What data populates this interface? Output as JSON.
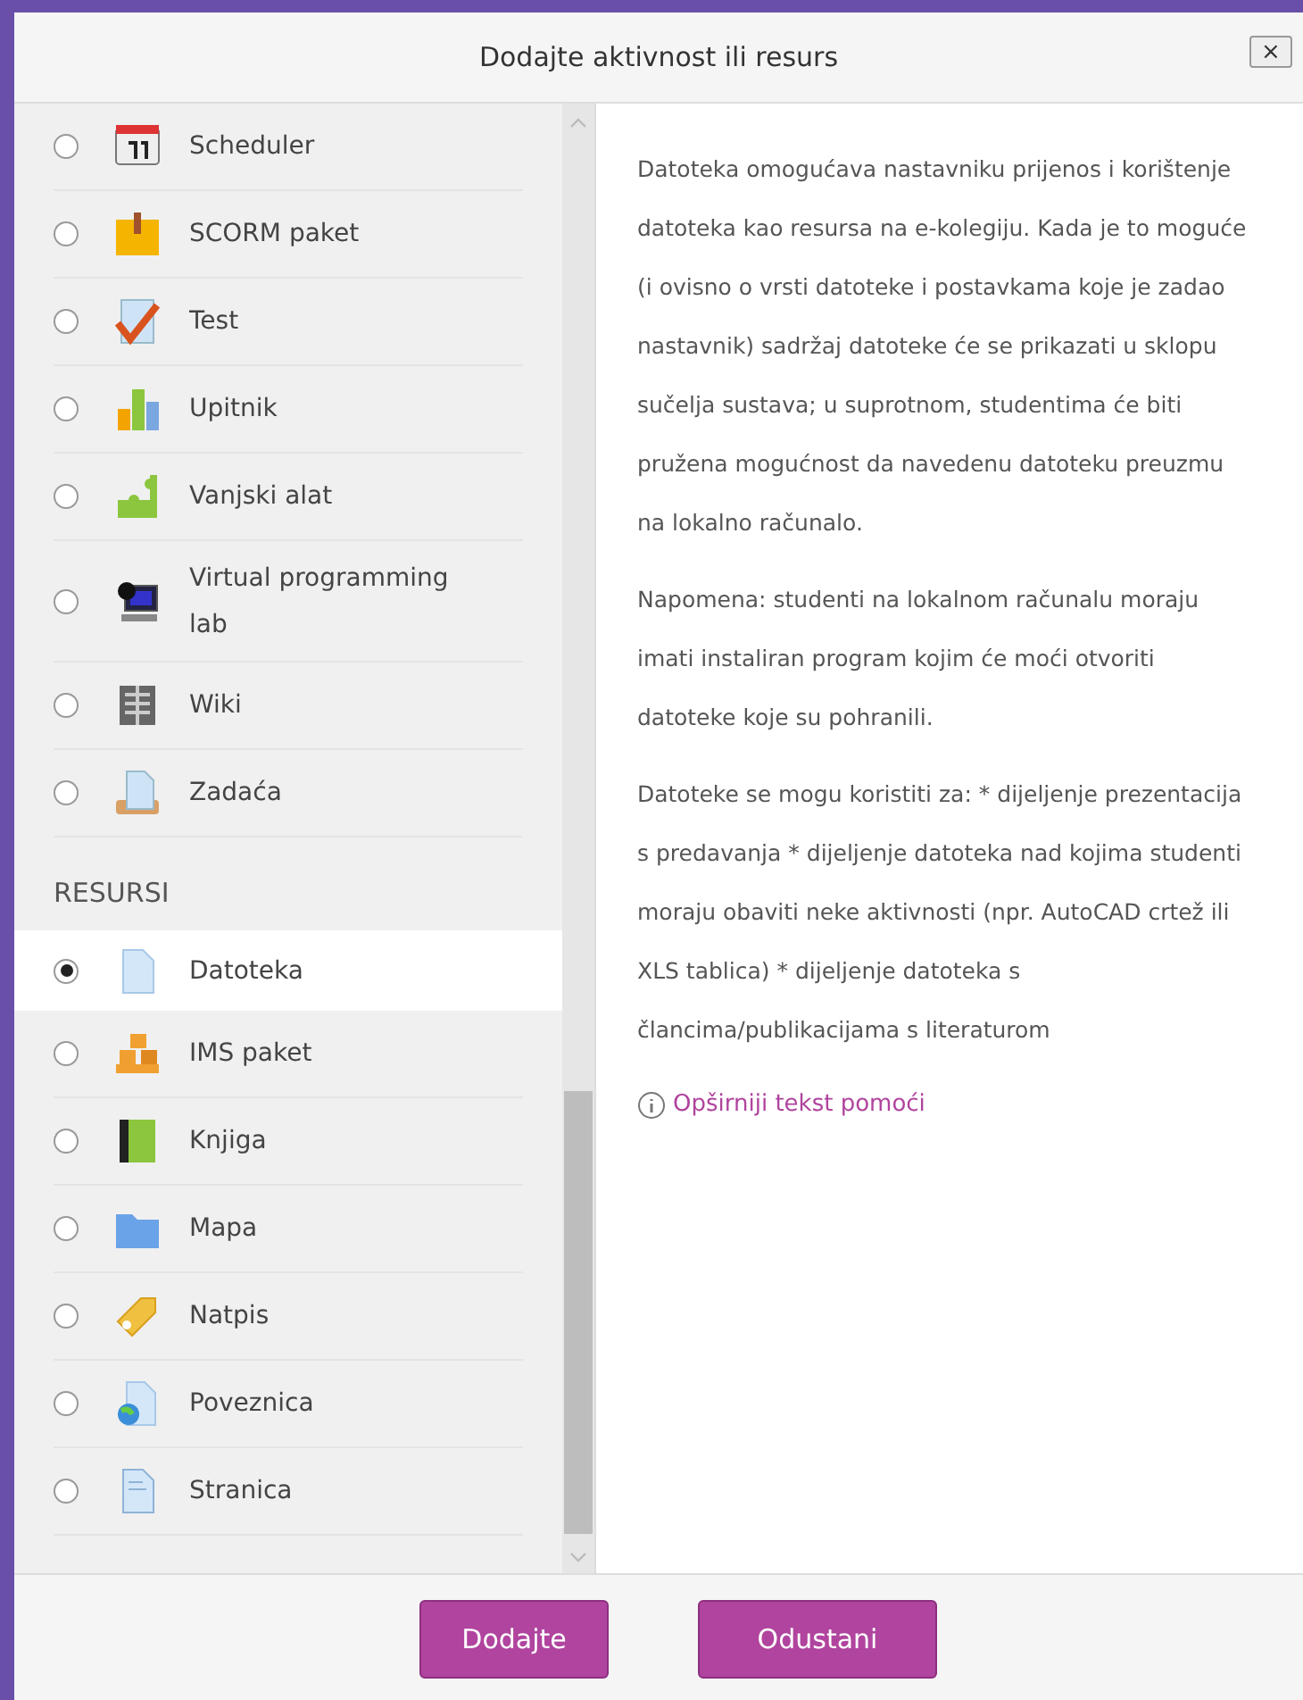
{
  "window": {
    "title": "Dodajte aktivnost ili resurs",
    "close": "×"
  },
  "activities": [
    {
      "label": "Scheduler",
      "kind": "scheduler",
      "selected": false
    },
    {
      "label": "SCORM paket",
      "kind": "scorm",
      "selected": false
    },
    {
      "label": "Test",
      "kind": "quiz",
      "selected": false
    },
    {
      "label": "Upitnik",
      "kind": "survey",
      "selected": false
    },
    {
      "label": "Vanjski alat",
      "kind": "tool",
      "selected": false
    },
    {
      "label": "Virtual programming lab",
      "kind": "vpl",
      "selected": false
    },
    {
      "label": "Wiki",
      "kind": "wiki",
      "selected": false
    },
    {
      "label": "Zadaća",
      "kind": "assignment",
      "selected": false
    }
  ],
  "resources_heading": "RESURSI",
  "resources": [
    {
      "label": "Datoteka",
      "kind": "file",
      "selected": true
    },
    {
      "label": "IMS paket",
      "kind": "ims",
      "selected": false
    },
    {
      "label": "Knjiga",
      "kind": "book",
      "selected": false
    },
    {
      "label": "Mapa",
      "kind": "folder",
      "selected": false
    },
    {
      "label": "Natpis",
      "kind": "label",
      "selected": false
    },
    {
      "label": "Poveznica",
      "kind": "url",
      "selected": false
    },
    {
      "label": "Stranica",
      "kind": "page",
      "selected": false
    }
  ],
  "description": [
    "Datoteka omogućava nastavniku prijenos i korištenje datoteka kao resursa na e-kolegiju. Kada je to moguće (i ovisno o vrsti datoteke i postavkama koje je zadao nastavnik) sadržaj datoteke će se prikazati u sklopu sučelja sustava; u suprotnom, studentima će biti pružena mogućnost da navedenu datoteku preuzmu na lokalno računalo.",
    "Napomena: studenti na lokalnom računalu moraju imati instaliran program kojim će moći otvoriti datoteke koje su pohranili.",
    "Datoteke se mogu koristiti za: * dijeljenje prezentacija s predavanja * dijeljenje datoteka nad kojima studenti moraju obaviti neke aktivnosti (npr. AutoCAD crtež ili XLS tablica) * dijeljenje datoteka s člancima/publikacijama s literaturom"
  ],
  "help_link": "Opširniji tekst pomoći",
  "buttons": [
    "Dodajte",
    "Odustani"
  ]
}
